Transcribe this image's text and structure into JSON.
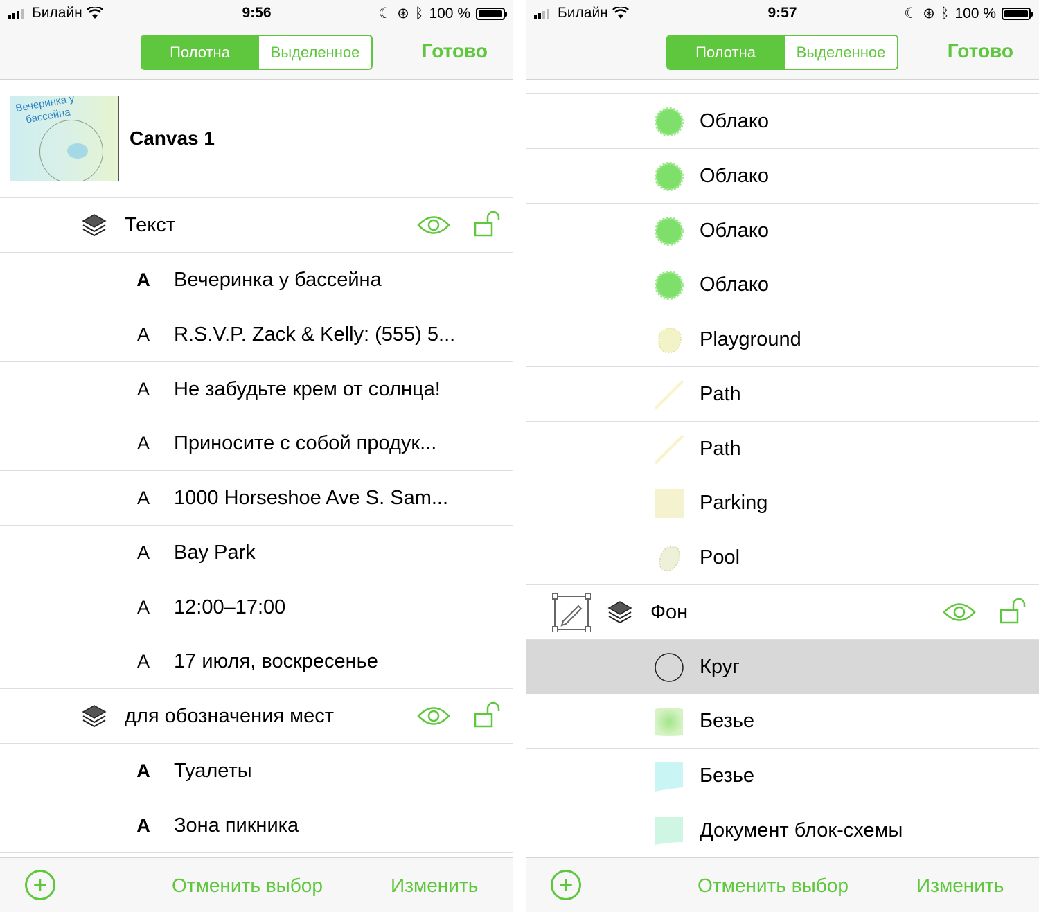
{
  "left": {
    "status": {
      "carrier": "Билайн",
      "time": "9:56",
      "battery": "100 %"
    },
    "nav": {
      "seg_canvas": "Полотна",
      "seg_selected": "Выделенное",
      "done": "Готово"
    },
    "canvas": {
      "title": "Canvas 1",
      "thumb_title_1": "Вечеринка у",
      "thumb_title_2": "бассейна"
    },
    "layer_text": {
      "label": "Текст"
    },
    "text_items": [
      {
        "glyph": "A",
        "label": "Вечеринка у  бассейна"
      },
      {
        "glyph": "A",
        "label": "R.S.V.P. Zack & Kelly: (555) 5..."
      },
      {
        "glyph": "A",
        "label": "Не забудьте крем от солнца!"
      },
      {
        "glyph": "A",
        "label": "Приносите с собой продук..."
      },
      {
        "glyph": "A",
        "label": "1000 Horseshoe Ave S. Sam..."
      },
      {
        "glyph": "A",
        "label": "Bay Park"
      },
      {
        "glyph": "A",
        "label": "12:00–17:00"
      },
      {
        "glyph": "A",
        "label": "17 июля, воскресенье"
      }
    ],
    "layer_places": {
      "label": "для обозначения мест"
    },
    "place_items": [
      {
        "glyph": "A",
        "label": "Туалеты"
      },
      {
        "glyph": "A",
        "label": "Зона пикника"
      }
    ],
    "toolbar": {
      "plus": "+",
      "deselect": "Отменить выбор",
      "edit": "Изменить"
    }
  },
  "right": {
    "status": {
      "carrier": "Билайн",
      "time": "9:57",
      "battery": "100 %"
    },
    "nav": {
      "seg_canvas": "Полотна",
      "seg_selected": "Выделенное",
      "done": "Готово"
    },
    "objects": [
      {
        "icon": "cloud-icon",
        "label": "Облако"
      },
      {
        "icon": "cloud-icon",
        "label": "Облако"
      },
      {
        "icon": "cloud-icon",
        "label": "Облако"
      },
      {
        "icon": "cloud-icon",
        "label": "Облако"
      },
      {
        "icon": "blob-icon",
        "label": "Playground"
      },
      {
        "icon": "path-icon",
        "label": "Path"
      },
      {
        "icon": "path-icon",
        "label": "Path"
      },
      {
        "icon": "square-icon",
        "label": "Parking"
      },
      {
        "icon": "pool-icon",
        "label": "Pool"
      }
    ],
    "layer_bg": {
      "label": "Фон"
    },
    "bg_items": [
      {
        "icon": "circle-icon",
        "label": "Круг",
        "selected": true
      },
      {
        "icon": "bezier-green-icon",
        "label": "Безье"
      },
      {
        "icon": "bezier-cyan-icon",
        "label": "Безье"
      },
      {
        "icon": "document-icon",
        "label": "Документ блок-схемы"
      }
    ],
    "toolbar": {
      "plus": "+",
      "deselect": "Отменить выбор",
      "edit": "Изменить"
    }
  },
  "colors": {
    "accent": "#5fc73d",
    "selected_row": "#d8d8d8"
  }
}
